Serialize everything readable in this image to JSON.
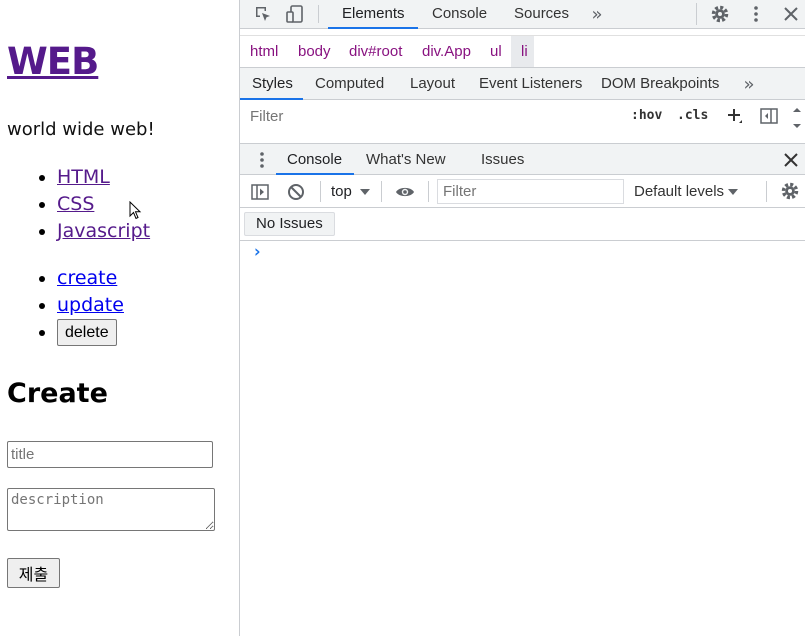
{
  "page": {
    "title": "WEB",
    "subtitle": "world wide web!",
    "topics": [
      "HTML",
      "CSS",
      "Javascript"
    ],
    "controls": {
      "create": "create",
      "update": "update",
      "delete": "delete"
    },
    "form": {
      "heading": "Create",
      "title_placeholder": "title",
      "description_placeholder": "description",
      "submit_label": "제출"
    }
  },
  "devtools": {
    "main_tabs": [
      "Elements",
      "Console",
      "Sources"
    ],
    "active_main_tab": "Elements",
    "breadcrumbs": [
      "html",
      "body",
      "div#root",
      "div.App",
      "ul",
      "li"
    ],
    "styles_tabs": [
      "Styles",
      "Computed",
      "Layout",
      "Event Listeners",
      "DOM Breakpoints"
    ],
    "active_styles_tab": "Styles",
    "styles_filter_placeholder": "Filter",
    "hov_label": ":hov",
    "cls_label": ".cls",
    "drawer_tabs": [
      "Console",
      "What's New",
      "Issues"
    ],
    "active_drawer_tab": "Console",
    "context": "top",
    "console_filter_placeholder": "Filter",
    "levels": "Default levels",
    "issues_label": "No Issues",
    "prompt": "›"
  },
  "colors": {
    "accent": "#1a73e8",
    "visited_link": "#551a8b",
    "link": "#0000ee",
    "dom_tag": "#881280"
  }
}
